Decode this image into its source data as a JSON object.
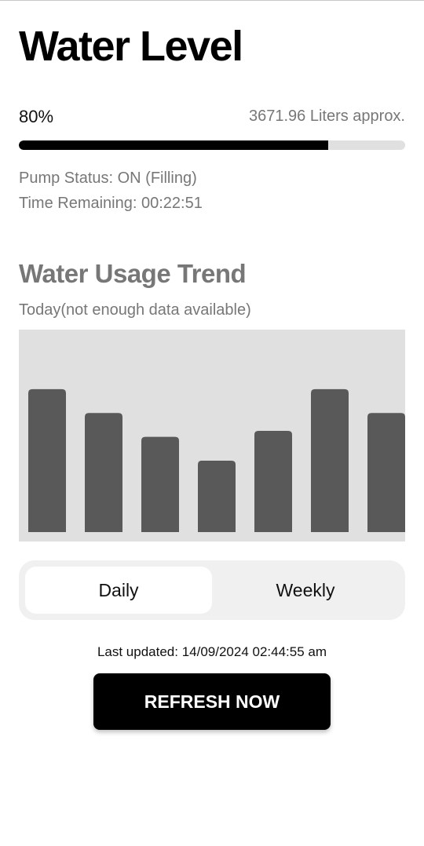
{
  "header": {
    "title": "Water Level"
  },
  "level": {
    "percent_label": "80%",
    "percent_value": 0.8,
    "liters_label": "3671.96 Liters approx.",
    "colors": {
      "fill": "#000000",
      "track": "#e0e0e0"
    }
  },
  "status": {
    "pump": "Pump Status: ON (Filling)",
    "time_remaining": "Time Remaining: 00:22:51"
  },
  "trend": {
    "title": "Water Usage Trend",
    "subtitle": "Today(not enough data available)"
  },
  "chart_data": {
    "type": "bar",
    "title": "",
    "xlabel": "",
    "ylabel": "",
    "categories": [
      "",
      "",
      "",
      "",
      "",
      "",
      ""
    ],
    "values": [
      6,
      5,
      4,
      3,
      4.25,
      6,
      5
    ],
    "ylim": [
      0,
      8.5
    ],
    "grid": false,
    "bar_color": "#595959",
    "background": "#e0e0e0"
  },
  "toggle": {
    "daily_label": "Daily",
    "weekly_label": "Weekly",
    "selected": "Daily"
  },
  "footer": {
    "last_updated": "Last updated: 14/09/2024 02:44:55 am",
    "refresh_label": "REFRESH NOW"
  }
}
